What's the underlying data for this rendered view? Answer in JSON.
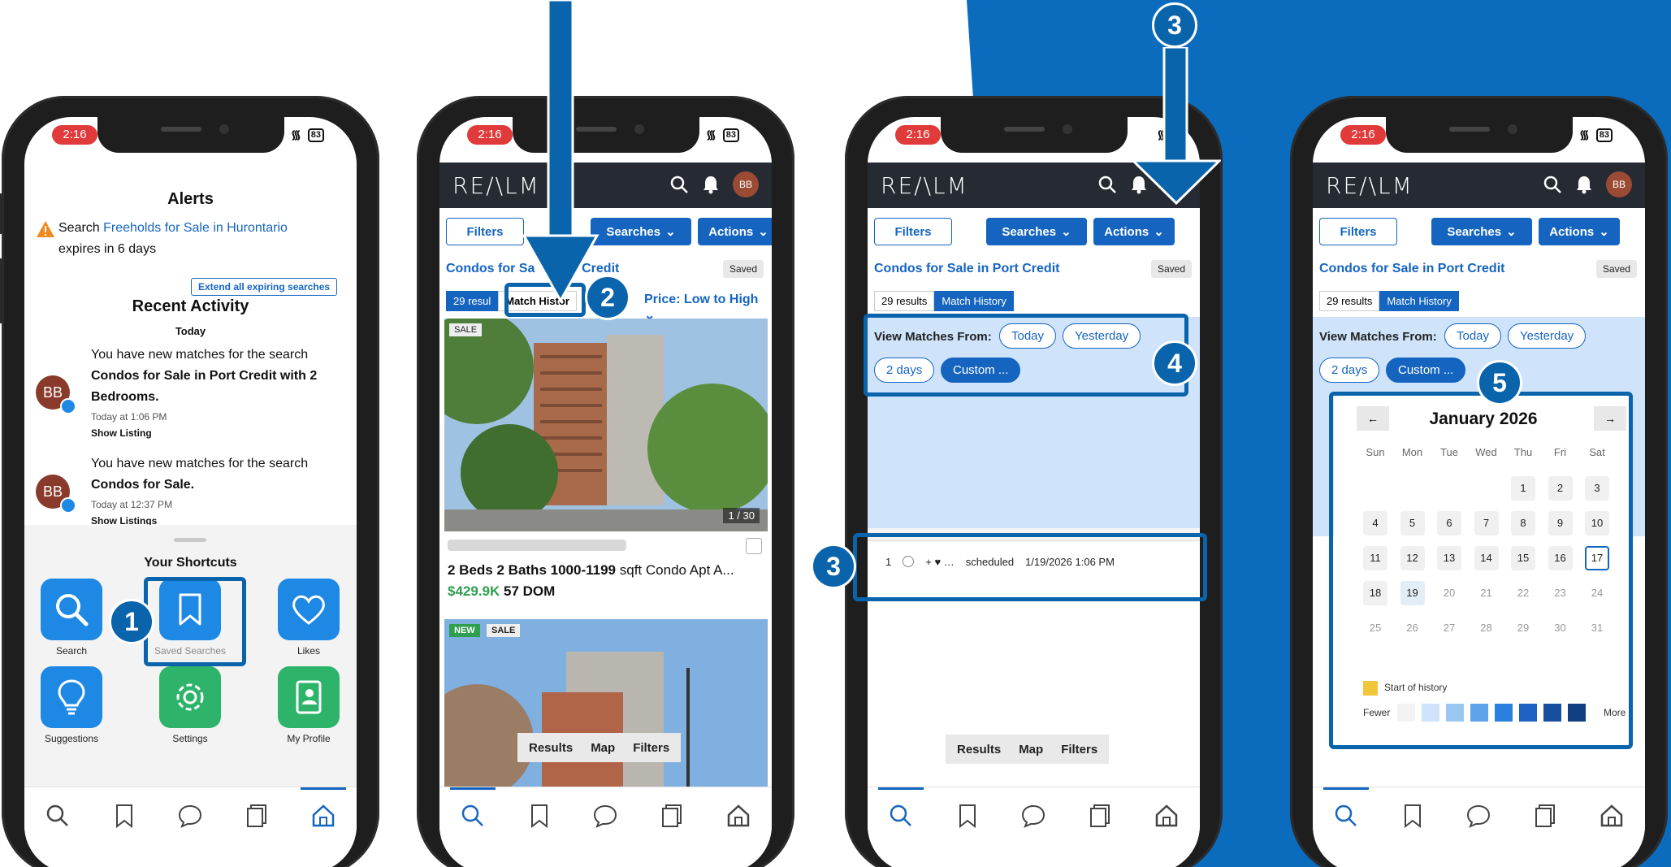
{
  "status": {
    "time": "2:16",
    "battery": "83"
  },
  "phone1": {
    "alerts_title": "Alerts",
    "alert_prefix": "Search ",
    "alert_link": "Freeholds for Sale in Hurontario",
    "alert_suffix": "expires in 6 days",
    "extend_button": "Extend all expiring searches",
    "recent_title": "Recent Activity",
    "recent_day": "Today",
    "activity": [
      {
        "avatar": "BB",
        "text": "You have new matches for the search",
        "link": "Condos for Sale in Port Credit with 2",
        "link2": "Bedrooms.",
        "time": "Today at 1:06 PM",
        "action": "Show Listing"
      },
      {
        "avatar": "BB",
        "text": "You have new matches for the search",
        "link": "Condos for Sale.",
        "time": "Today at 12:37 PM",
        "action": "Show Listings"
      }
    ],
    "shortcuts_title": "Your Shortcuts",
    "shortcuts": [
      "Search",
      "Saved Searches",
      "Likes",
      "Suggestions",
      "Settings",
      "My Profile"
    ]
  },
  "realm": {
    "logo": "RE∕\\LM",
    "avatar": "BB",
    "filters": "Filters",
    "searches": "Searches",
    "actions": "Actions",
    "search_title": "Condos for Sale in Port Credit",
    "saved": "Saved",
    "results_tab": "29 results",
    "match_tab": "Match History",
    "price_sort": "Price: Low to High"
  },
  "phone2": {
    "title_partial": "Condos for Sa",
    "title_partial2": "ort Credit",
    "match_tab_partial": "Match Histor",
    "results_partial": "29 resul",
    "listing1": {
      "tag": "SALE",
      "counter": "1 / 30",
      "beds": "2 Beds",
      "baths": "2 Baths",
      "sqft": "1000-1199",
      "sqft_unit": "sqft",
      "type": "Condo Apt",
      "type_more": "A...",
      "price": "$429.9K",
      "dom": "57 DOM"
    },
    "listing2": {
      "tag_new": "NEW",
      "tag_sale": "SALE"
    },
    "floating": [
      "Results",
      "Map",
      "Filters"
    ]
  },
  "phone3": {
    "view_label": "View Matches From:",
    "pills": [
      "Today",
      "Yesterday",
      "2 days",
      "Custom ..."
    ],
    "row": {
      "num": "1",
      "status": "scheduled",
      "date": "1/19/2026 1:06 PM"
    },
    "floating": [
      "Results",
      "Map",
      "Filters"
    ]
  },
  "phone4": {
    "month": "January 2026",
    "prev": "←",
    "next": "→",
    "weekdays": [
      "Sun",
      "Mon",
      "Tue",
      "Wed",
      "Thu",
      "Fri",
      "Sat"
    ],
    "legend_start": "Start of history",
    "legend_fewer": "Fewer",
    "legend_more": "More",
    "heat_colors": [
      "#f3f3f3",
      "#cfe3fb",
      "#9cc6f2",
      "#5ea2ea",
      "#2b7fe0",
      "#1e63c4",
      "#174fa0",
      "#123f82"
    ]
  },
  "badges": [
    "1",
    "2",
    "3",
    "3",
    "4",
    "5"
  ],
  "colors": {
    "accent": "#1565c0",
    "callout": "#0a64ac",
    "bg_blue": "#0b6cbd"
  }
}
